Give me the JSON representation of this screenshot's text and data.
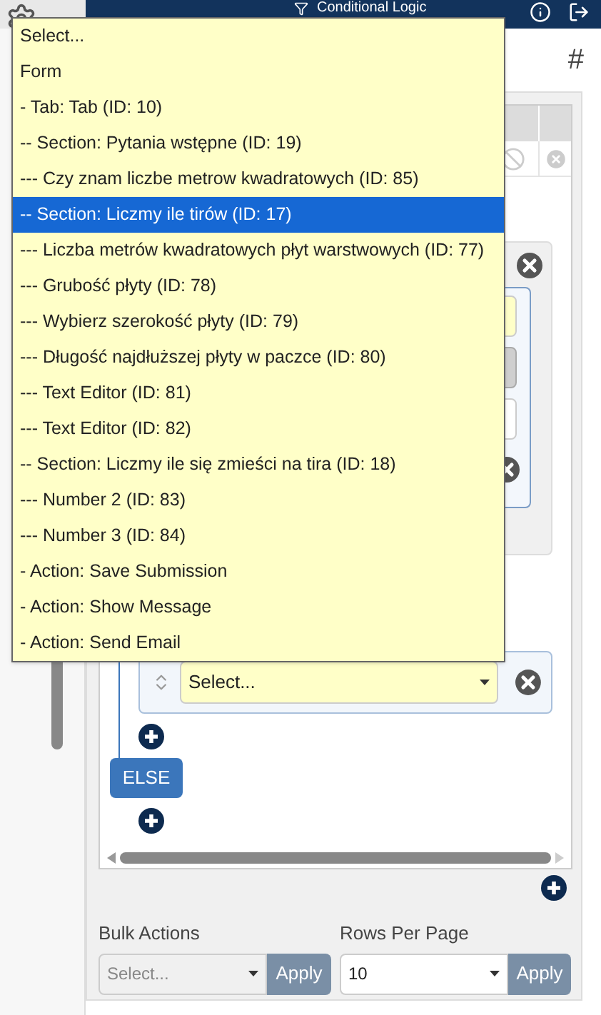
{
  "header": {
    "title": "Conditional Logic"
  },
  "column_header": "#",
  "dropdown": {
    "items": [
      {
        "label": "Select...",
        "selected": false
      },
      {
        "label": "Form",
        "selected": false
      },
      {
        "label": "- Tab: Tab (ID: 10)",
        "selected": false
      },
      {
        "label": "-- Section: Pytania wstępne (ID: 19)",
        "selected": false
      },
      {
        "label": "--- Czy znam liczbe metrow kwadratowych (ID: 85)",
        "selected": false
      },
      {
        "label": "-- Section: Liczmy ile tirów (ID: 17)",
        "selected": true
      },
      {
        "label": "--- Liczba metrów kwadratowych płyt warstwowych (ID: 77)",
        "selected": false
      },
      {
        "label": "--- Grubość płyty (ID: 78)",
        "selected": false
      },
      {
        "label": "--- Wybierz szerokość płyty (ID: 79)",
        "selected": false
      },
      {
        "label": "--- Długość najdłuższej płyty w paczce (ID: 80)",
        "selected": false
      },
      {
        "label": "--- Text Editor (ID: 81)",
        "selected": false
      },
      {
        "label": "--- Text Editor (ID: 82)",
        "selected": false
      },
      {
        "label": "-- Section: Liczmy ile się zmieści na tira (ID: 18)",
        "selected": false
      },
      {
        "label": "--- Number 2 (ID: 83)",
        "selected": false
      },
      {
        "label": "--- Number 3 (ID: 84)",
        "selected": false
      },
      {
        "label": "- Action: Save Submission",
        "selected": false
      },
      {
        "label": "- Action: Show Message",
        "selected": false
      },
      {
        "label": "- Action: Send Email",
        "selected": false
      }
    ]
  },
  "action_select": {
    "value": "Select..."
  },
  "else_button": "ELSE",
  "bulk_actions": {
    "label": "Bulk Actions",
    "placeholder": "Select...",
    "button": "Apply"
  },
  "rows_per_page": {
    "label": "Rows Per Page",
    "value": "10",
    "button": "Apply"
  }
}
